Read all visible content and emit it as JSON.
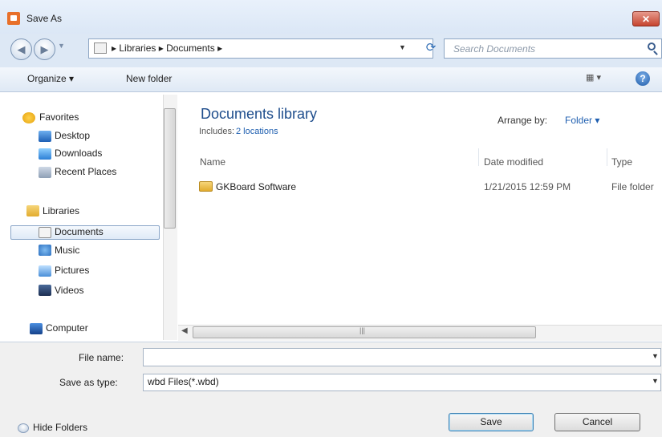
{
  "window": {
    "title": "Save As",
    "close_label": "✕"
  },
  "nav": {
    "back_label": "◀",
    "forward_label": "▶",
    "address": {
      "crumbs": "▸ Libraries ▸ Documents ▸"
    },
    "search": {
      "placeholder": "Search Documents"
    }
  },
  "toolbar": {
    "organize_label": "Organize ▾",
    "new_folder_label": "New folder",
    "views_label": "▦ ▾",
    "help_label": "?"
  },
  "sidebar": {
    "items": [
      {
        "label": "Favorites",
        "icon": "star-icon"
      },
      {
        "label": "Desktop",
        "icon": "desktop-icon"
      },
      {
        "label": "Downloads",
        "icon": "downloads-icon"
      },
      {
        "label": "Recent Places",
        "icon": "recent-places-icon"
      },
      {
        "label": "Libraries",
        "icon": "libraries-icon"
      },
      {
        "label": "Documents",
        "icon": "documents-icon",
        "selected": true
      },
      {
        "label": "Music",
        "icon": "music-icon"
      },
      {
        "label": "Pictures",
        "icon": "pictures-icon"
      },
      {
        "label": "Videos",
        "icon": "videos-icon"
      },
      {
        "label": "Computer",
        "icon": "computer-icon"
      }
    ]
  },
  "library": {
    "title": "Documents library",
    "includes_label": "Includes:",
    "includes_link": "2 locations",
    "arrange_label": "Arrange by:",
    "arrange_value": "Folder ▾"
  },
  "file_list": {
    "columns": [
      "Name",
      "Date modified",
      "Type"
    ],
    "rows": [
      {
        "name": "GKBoard Software",
        "date_modified": "1/21/2015 12:59 PM",
        "type": "File folder"
      }
    ]
  },
  "form": {
    "file_name_label": "File name:",
    "file_name_value": "",
    "save_type_label": "Save as type:",
    "save_type_value": "wbd Files(*.wbd)"
  },
  "buttons": {
    "hide_folders": "Hide Folders",
    "save": "Save",
    "cancel": "Cancel"
  },
  "colors": {
    "title_bar": "#dbe7f6",
    "library_title": "#1e4d8c",
    "link": "#1f5fb0"
  }
}
